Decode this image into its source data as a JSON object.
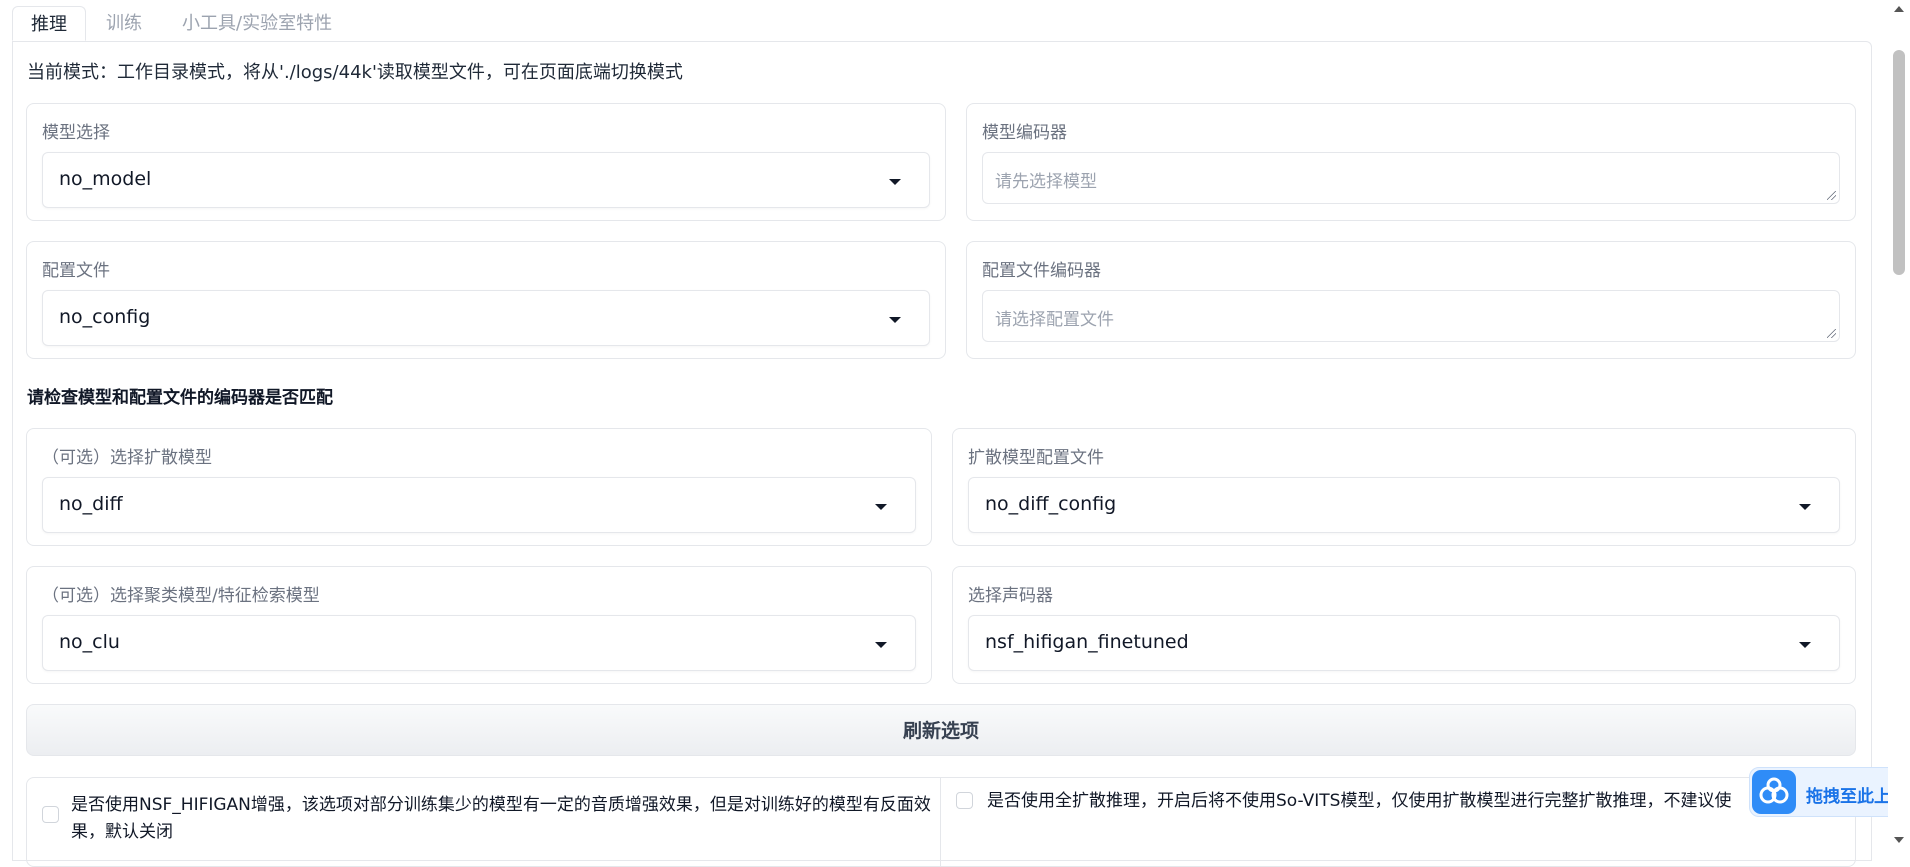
{
  "tabs": [
    {
      "label": "推理"
    },
    {
      "label": "训练"
    },
    {
      "label": "小工具/实验室特性"
    }
  ],
  "mode_text": "当前模式：工作目录模式，将从'./logs/44k'读取模型文件，可在页面底端切换模式",
  "model_select": {
    "label": "模型选择",
    "value": "no_model"
  },
  "model_encoder": {
    "label": "模型编码器",
    "placeholder": "请先选择模型"
  },
  "config_file": {
    "label": "配置文件",
    "value": "no_config"
  },
  "config_encoder": {
    "label": "配置文件编码器",
    "placeholder": "请选择配置文件"
  },
  "warning_text": "请检查模型和配置文件的编码器是否匹配",
  "diff_model": {
    "label": "（可选）选择扩散模型",
    "value": "no_diff"
  },
  "diff_config": {
    "label": "扩散模型配置文件",
    "value": "no_diff_config"
  },
  "cluster_model": {
    "label": "（可选）选择聚类模型/特征检索模型",
    "value": "no_clu"
  },
  "vocoder": {
    "label": "选择声码器",
    "value": "nsf_hifigan_finetuned"
  },
  "refresh_button": "刷新选项",
  "checkbox_nsf": "是否使用NSF_HIFIGAN增强，该选项对部分训练集少的模型有一定的音质增强效果，但是对训练好的模型有反面效果，默认关闭",
  "checkbox_full_diff": "是否使用全扩散推理，开启后将不使用So-VITS模型，仅使用扩散模型进行完整扩散推理，不建议使",
  "upload_badge": "拖拽至此上传"
}
